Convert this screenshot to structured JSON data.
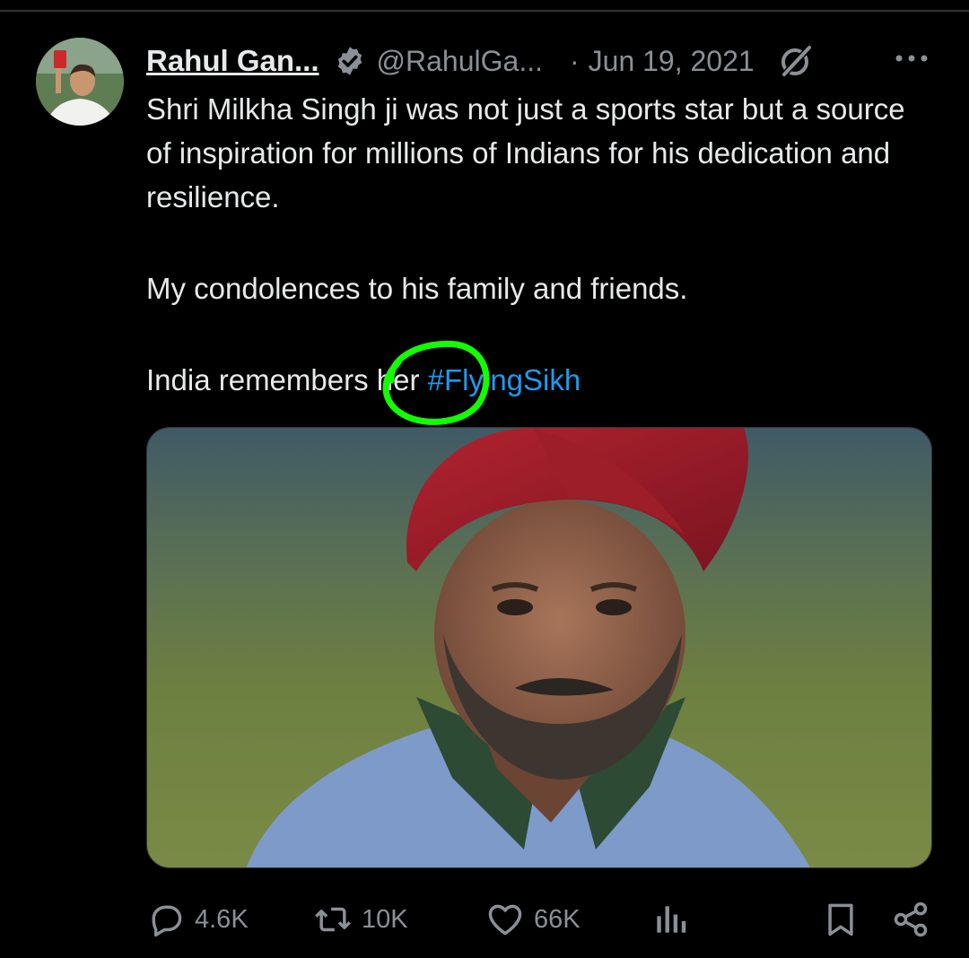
{
  "tweet": {
    "author_name": "Rahul Gan...",
    "handle": "@RahulGa...",
    "separator": "·",
    "date": "Jun 19, 2021",
    "verified_icon": "verified-badge-icon",
    "paragraphs": [
      "Shri Milkha Singh ji was not just a sports star but a source of inspiration for millions of Indians for his dedication and resilience.",
      "My condolences to his family and friends."
    ],
    "last_line_text": "India remembers her ",
    "hashtag": "#FlyingSikh",
    "annotation_color": "#12ff00"
  },
  "actions": {
    "replies": "4.6K",
    "reposts": "10K",
    "likes": "66K"
  },
  "colors": {
    "background": "#000000",
    "text": "#e7e9ea",
    "muted": "#8b9096",
    "link": "#1d9bf0"
  }
}
